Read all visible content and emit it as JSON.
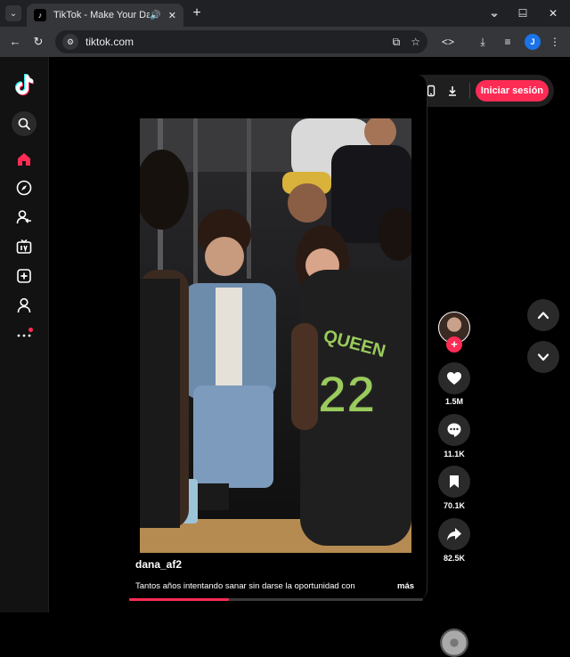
{
  "browser": {
    "tab_title": "TikTok - Make Your Day",
    "url": "tiktok.com",
    "profile_initial": "J"
  },
  "header": {
    "login_label": "Iniciar sesión"
  },
  "post": {
    "author": "dana_af2",
    "caption": "Tantos años intentando sanar sin darse la oportunidad con",
    "more_label": "más",
    "progress": 0.34,
    "jersey_text": "QUEEN",
    "jersey_number": "22"
  },
  "actions": {
    "likes": "1.5M",
    "comments": "11.1K",
    "saves": "70.1K",
    "shares": "82.5K"
  },
  "icons": {
    "logo": "tiktok-logo",
    "search": "search-icon",
    "home": "home-icon",
    "explore": "compass-icon",
    "following": "following-icon",
    "live": "live-tv-icon",
    "upload": "upload-icon",
    "profile": "profile-icon",
    "more": "more-icon"
  },
  "colors": {
    "accent": "#fe2c55",
    "sidebar_bg": "#121212",
    "button_bg": "#2a2a2a"
  }
}
